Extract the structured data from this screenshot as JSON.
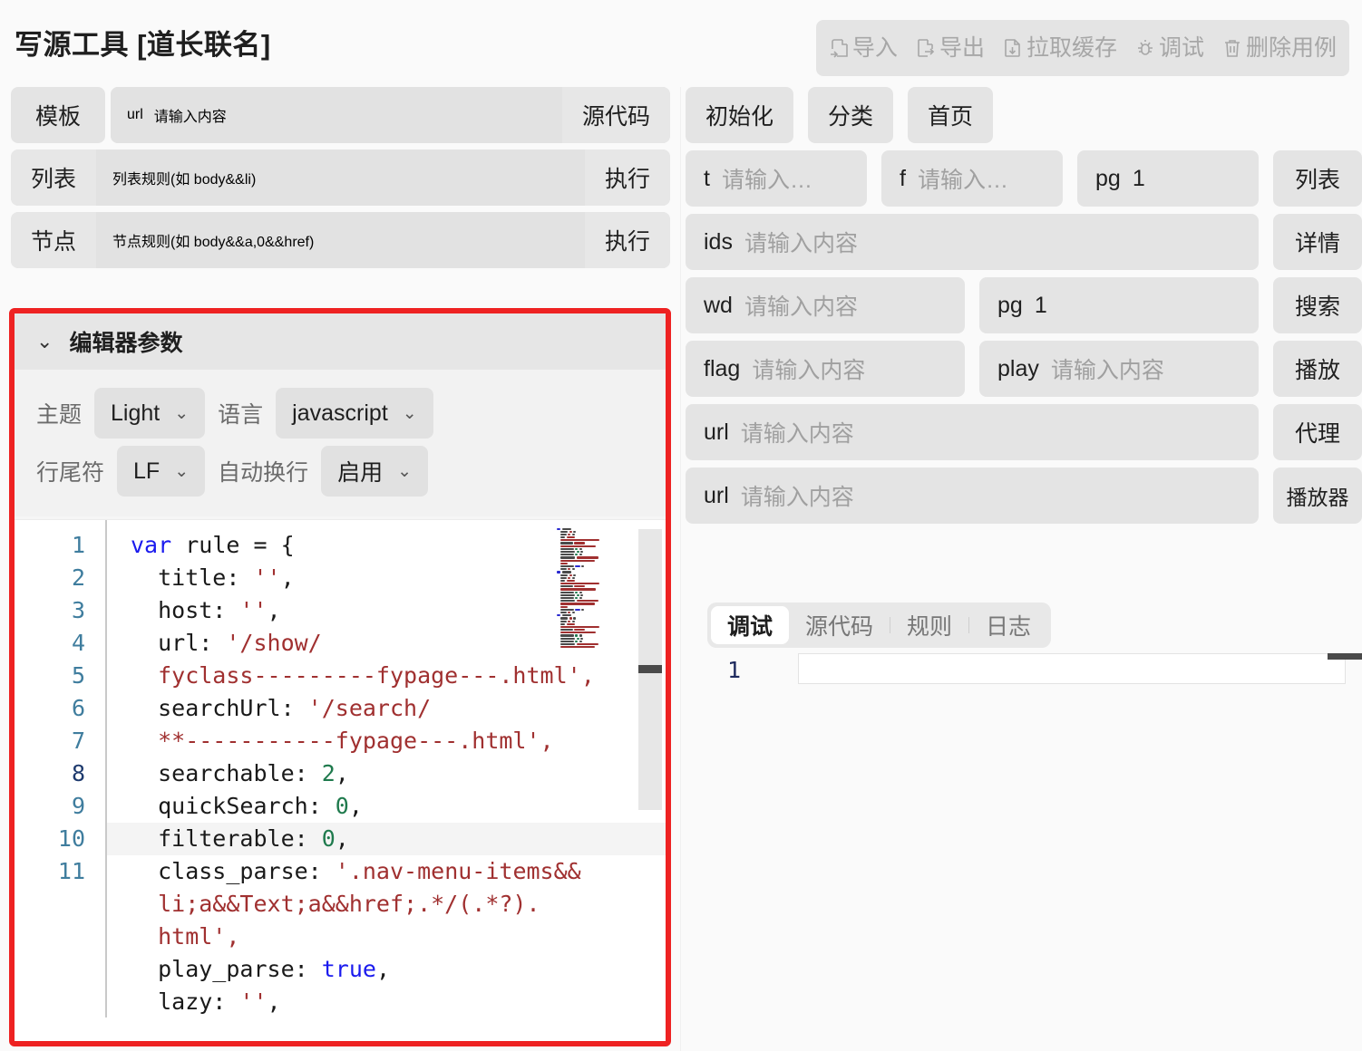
{
  "header": {
    "title": "写源工具 [道长联名]",
    "toolbar": [
      {
        "label": "导入",
        "icon": "import-icon"
      },
      {
        "label": "导出",
        "icon": "export-icon"
      },
      {
        "label": "拉取缓存",
        "icon": "download-cache-icon"
      },
      {
        "label": "调试",
        "icon": "bug-icon"
      },
      {
        "label": "删除用例",
        "icon": "trash-icon"
      }
    ]
  },
  "left": {
    "row_template": {
      "button": "模板",
      "url_label": "url",
      "url_value": "",
      "url_placeholder": "请输入内容",
      "source_button": "源代码"
    },
    "row_list": {
      "button": "列表",
      "input_label": "",
      "input_value": "",
      "placeholder": "列表规则(如 body&&li)",
      "action": "执行"
    },
    "row_node": {
      "button": "节点",
      "input_value": "",
      "placeholder": "节点规则(如 body&&a,0&&href)",
      "action": "执行"
    },
    "editor_params": {
      "title": "编辑器参数",
      "chevron": "chevron-down",
      "fields": [
        {
          "label": "主题",
          "value": "Light"
        },
        {
          "label": "语言",
          "value": "javascript"
        },
        {
          "label": "行尾符",
          "value": "LF"
        },
        {
          "label": "自动换行",
          "value": "启用"
        }
      ]
    },
    "code": {
      "active_line": 8,
      "lines": [
        {
          "n": "1",
          "tokens": [
            {
              "t": "var ",
              "c": "kw"
            },
            {
              "t": "rule = {",
              "c": ""
            }
          ]
        },
        {
          "n": "2",
          "tokens": [
            {
              "t": "  title: ",
              "c": ""
            },
            {
              "t": "''",
              "c": "str"
            },
            {
              "t": ",",
              "c": ""
            }
          ]
        },
        {
          "n": "3",
          "tokens": [
            {
              "t": "  host: ",
              "c": ""
            },
            {
              "t": "''",
              "c": "str"
            },
            {
              "t": ",",
              "c": ""
            }
          ]
        },
        {
          "n": "4",
          "tokens": [
            {
              "t": "  url: ",
              "c": ""
            },
            {
              "t": "'/show/",
              "c": "str"
            }
          ]
        },
        {
          "n": "",
          "tokens": [
            {
              "t": "  fyclass---------fypage---.html',",
              "c": "str"
            }
          ]
        },
        {
          "n": "5",
          "tokens": [
            {
              "t": "  searchUrl: ",
              "c": ""
            },
            {
              "t": "'/search/",
              "c": "str"
            }
          ]
        },
        {
          "n": "",
          "tokens": [
            {
              "t": "  **-----------fypage---.html',",
              "c": "str"
            }
          ]
        },
        {
          "n": "6",
          "tokens": [
            {
              "t": "  searchable: ",
              "c": ""
            },
            {
              "t": "2",
              "c": "num"
            },
            {
              "t": ",",
              "c": ""
            }
          ]
        },
        {
          "n": "7",
          "tokens": [
            {
              "t": "  quickSearch: ",
              "c": ""
            },
            {
              "t": "0",
              "c": "num"
            },
            {
              "t": ",",
              "c": ""
            }
          ]
        },
        {
          "n": "8",
          "tokens": [
            {
              "t": "  filterable: ",
              "c": ""
            },
            {
              "t": "0",
              "c": "num"
            },
            {
              "t": ",",
              "c": ""
            }
          ]
        },
        {
          "n": "9",
          "tokens": [
            {
              "t": "  class_parse: ",
              "c": ""
            },
            {
              "t": "'.nav-menu-items&&",
              "c": "str"
            }
          ]
        },
        {
          "n": "",
          "tokens": [
            {
              "t": "  li;a&&Text;a&&href;.*/(.*?).",
              "c": "str"
            }
          ]
        },
        {
          "n": "",
          "tokens": [
            {
              "t": "  html',",
              "c": "str"
            }
          ]
        },
        {
          "n": "10",
          "tokens": [
            {
              "t": "  play_parse: ",
              "c": ""
            },
            {
              "t": "true",
              "c": "bool"
            },
            {
              "t": ",",
              "c": ""
            }
          ]
        },
        {
          "n": "11",
          "tokens": [
            {
              "t": "  lazy: ",
              "c": ""
            },
            {
              "t": "''",
              "c": "str"
            },
            {
              "t": ",",
              "c": ""
            }
          ]
        }
      ]
    }
  },
  "right": {
    "top_buttons": [
      "初始化",
      "分类",
      "首页"
    ],
    "row_list": {
      "t_label": "t",
      "t_placeholder": "请输入…",
      "f_label": "f",
      "f_placeholder": "请输入…",
      "pg_label": "pg",
      "pg_value": "1",
      "action": "列表"
    },
    "row_ids": {
      "label": "ids",
      "placeholder": "请输入内容",
      "action": "详情"
    },
    "row_search": {
      "wd_label": "wd",
      "wd_placeholder": "请输入内容",
      "pg_label": "pg",
      "pg_value": "1",
      "action": "搜索"
    },
    "row_play": {
      "flag_label": "flag",
      "flag_placeholder": "请输入内容",
      "play_label": "play",
      "play_placeholder": "请输入内容",
      "action": "播放"
    },
    "row_proxy": {
      "label": "url",
      "placeholder": "请输入内容",
      "action": "代理"
    },
    "row_player": {
      "label": "url",
      "placeholder": "请输入内容",
      "action": "播放器"
    },
    "debug": {
      "tabs": [
        "调试",
        "源代码",
        "规则",
        "日志"
      ],
      "active_tab": "调试",
      "line_number": "1",
      "content": ""
    }
  },
  "colors": {
    "highlight_border": "#ee2222",
    "field_bg": "#e4e4e4",
    "page_bg": "#fafafa",
    "keyword": "#1a1aee",
    "string": "#a03030",
    "number": "#1f7a4d"
  }
}
